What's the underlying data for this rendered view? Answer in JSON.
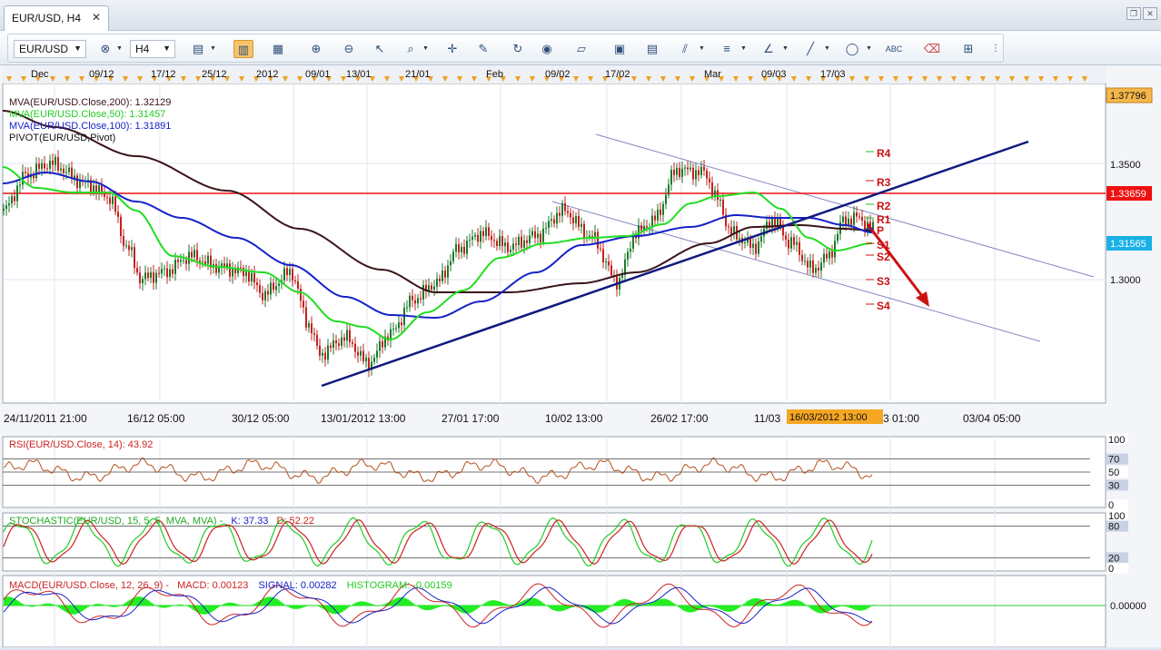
{
  "tab": {
    "title": "EUR/USD, H4"
  },
  "toolbar": {
    "symbol": "EUR/USD",
    "timeframe": "H4"
  },
  "price_chart": {
    "legend": {
      "mva200": "MVA(EUR/USD.Close,200): 1.32129",
      "mva50": "MVA(EUR/USD.Close,50): 1.31457",
      "mva100": "MVA(EUR/USD.Close,100): 1.31891",
      "pivot": "PIVOT(EUR/USD,Pivot)"
    },
    "top_dates": [
      "Dec",
      "09/12",
      "17/12",
      "25/12",
      "2012",
      "09/01",
      "13/01",
      "21/01",
      "Feb",
      "09/02",
      "17/02",
      "Mar",
      "09/03",
      "17/03"
    ],
    "bottom_dates": [
      "24/11/2011 21:00",
      "16/12 05:00",
      "30/12 05:00",
      "13/01/2012 13:00",
      "27/01 17:00",
      "10/02 13:00",
      "26/02 17:00",
      "11/03",
      "3 01:00",
      "03/04 05:00"
    ],
    "cursor_date": "16/03/2012 13:00",
    "price_labels": [
      "1.3500",
      "1.3000"
    ],
    "price_top": "1.37796",
    "price_resistance": "1.33659",
    "price_current": "1.31565",
    "pivot_labels": [
      "R4",
      "R3",
      "R2",
      "R1",
      "P",
      "S1",
      "S2",
      "S3",
      "S4"
    ],
    "colors": {
      "mva200": "#3a1418",
      "mva50": "#22dd22",
      "mva100": "#1522c8",
      "resistance": "#ee1111",
      "arrow": "#cc1111"
    }
  },
  "rsi": {
    "title": "RSI(EUR/USD.Close, 14): 43.92",
    "levels": [
      "100",
      "70",
      "50",
      "30",
      "0"
    ]
  },
  "stochastic": {
    "title_main": "STOCHASTIC(EUR/USD, 15, 5, 5, MVA, MVA) -",
    "k_value": "K: 37.33",
    "d_value": "D: 52.22",
    "levels": [
      "100",
      "80",
      "20",
      "0"
    ]
  },
  "macd": {
    "title_main": "MACD(EUR/USD.Close, 12, 26, 9) -",
    "macd_value": "MACD: 0.00123",
    "signal_value": "SIGNAL: 0.00282",
    "histogram_value": "HISTOGRAM: -0.00159",
    "level": "0.00000"
  }
}
